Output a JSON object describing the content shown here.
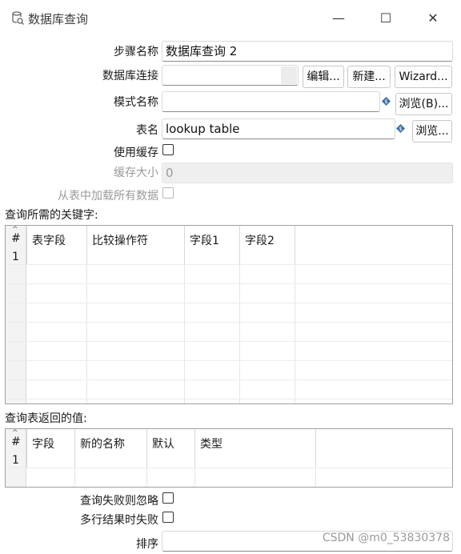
{
  "window": {
    "title": "数据库查询",
    "controls": {
      "minimize": "—",
      "maximize": "☐",
      "close": "✕"
    }
  },
  "form": {
    "step_name": {
      "label": "步骤名称",
      "value": "数据库查询 2"
    },
    "connection": {
      "label": "数据库连接",
      "value": "",
      "edit_button": "编辑...",
      "new_button": "新建...",
      "wizard_button": "Wizard..."
    },
    "schema": {
      "label": "模式名称",
      "value": "",
      "browse_button": "浏览(B)..."
    },
    "table": {
      "label": "表名",
      "value": "lookup table",
      "browse_button": "浏览..."
    },
    "use_cache": {
      "label": "使用缓存",
      "checked": false
    },
    "cache_size": {
      "label": "缓存大小",
      "value": "0",
      "disabled": true
    },
    "load_all": {
      "label": "从表中加载所有数据",
      "checked": false,
      "disabled": true
    }
  },
  "keys_section": {
    "title": "查询所需的关键字:",
    "columns": [
      "#",
      "表字段",
      "比较操作符",
      "字段1",
      "字段2"
    ],
    "rows": [
      [
        "1",
        "",
        "",
        "",
        ""
      ]
    ]
  },
  "return_section": {
    "title": "查询表返回的值:",
    "columns": [
      "#",
      "字段",
      "新的名称",
      "默认",
      "类型"
    ],
    "rows": [
      [
        "1",
        "",
        "",
        "",
        ""
      ]
    ]
  },
  "options": {
    "fail_ignore": {
      "label": "查询失败则忽略",
      "checked": false
    },
    "multi_fail": {
      "label": "多行结果时失败",
      "checked": false
    },
    "order_by": {
      "label": "排序",
      "value": ""
    }
  },
  "watermark": "CSDN @m0_53830378"
}
